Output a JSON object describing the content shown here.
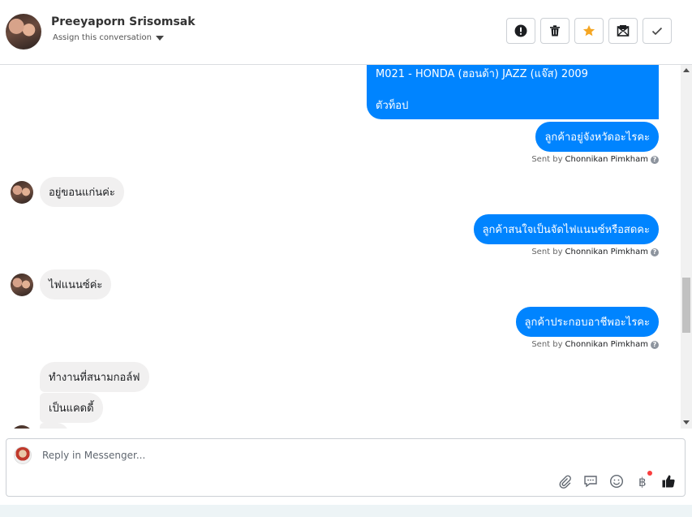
{
  "header": {
    "contact_name": "Preeyaporn Srisomsak",
    "assign_label": "Assign this conversation",
    "actions": [
      {
        "name": "mark-spam-button",
        "icon": "exclamation-circle-icon"
      },
      {
        "name": "delete-button",
        "icon": "trash-icon"
      },
      {
        "name": "star-button",
        "icon": "star-icon",
        "color": "#f5a623"
      },
      {
        "name": "mark-unread-button",
        "icon": "envelope-icon"
      },
      {
        "name": "mark-done-button",
        "icon": "checkmark-icon"
      }
    ]
  },
  "thread": {
    "top_message": {
      "line1": "M021 - HONDA (ฮอนด้า) JAZZ (แจ๊ส) 2009",
      "line2": "ตัวท็อป"
    },
    "msg_province": "ลูกค้าอยู่จังหวัดอะไรคะ",
    "sent_prefix": "Sent by",
    "agent_name": "Chonnikan Pimkham",
    "reply_khon_kaen": "อยู่ขอนแก่นค่ะ",
    "msg_interest": "ลูกค้าสนใจเป็นจัดไฟแนนซ์หรือสดคะ",
    "reply_finance": "ไฟแนนซ์ค่ะ",
    "msg_occupation": "ลูกค้าประกอบอาชีพอะไรคะ",
    "reply_golf": "ทำงานที่สนามกอล์ฟ",
    "reply_caddy": "เป็นแคดดี้"
  },
  "composer": {
    "placeholder": "Reply in Messenger...",
    "tools": [
      "paperclip-icon",
      "chat-template-icon",
      "emoji-icon",
      "baht-payment-icon",
      "thumbs-up-icon"
    ]
  },
  "colors": {
    "outgoing_bubble": "#0084ff",
    "incoming_bubble": "#f1f0f0",
    "star": "#f5a623",
    "notification_dot": "#fa3e3e"
  }
}
